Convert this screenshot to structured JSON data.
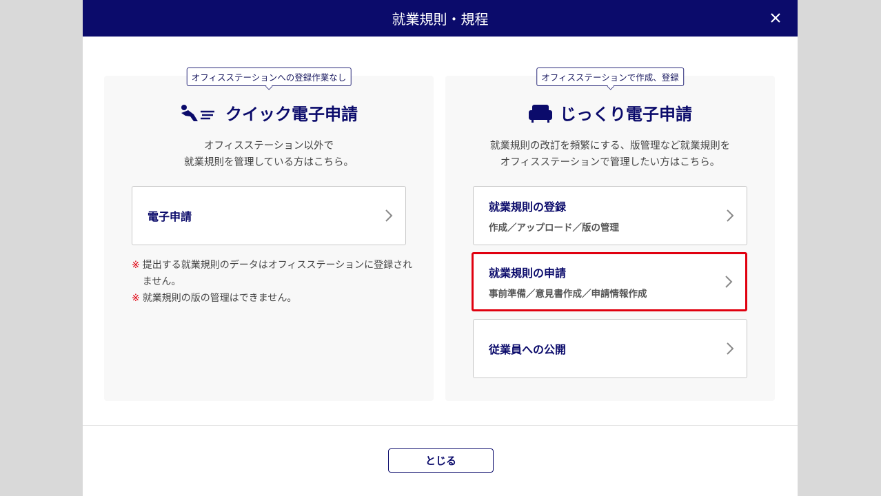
{
  "header": {
    "title": "就業規則・規程"
  },
  "left": {
    "callout": "オフィスステーションへの登録作業なし",
    "title": "クイック電子申請",
    "desc": [
      "オフィスステーション以外で",
      "就業規則を管理している方はこちら。"
    ],
    "button": {
      "label": "電子申請"
    },
    "notes": [
      {
        "mark": "※",
        "text": "提出する就業規則のデータはオフィスステーションに登録されません。"
      },
      {
        "mark": "※",
        "text": "就業規則の版の管理はできません。"
      }
    ]
  },
  "right": {
    "callout": "オフィスステーションで作成、登録",
    "title": "じっくり電子申請",
    "desc": [
      "就業規則の改訂を頻繁にする、版管理など就業規則を",
      "オフィスステーションで管理したい方はこちら。"
    ],
    "buttons": [
      {
        "label": "就業規則の登録",
        "sub": "作成／アップロード／版の管理"
      },
      {
        "label": "就業規則の申請",
        "sub": "事前準備／意見書作成／申請情報作成"
      },
      {
        "label": "従業員への公開"
      }
    ]
  },
  "footer": {
    "close_label": "とじる"
  }
}
